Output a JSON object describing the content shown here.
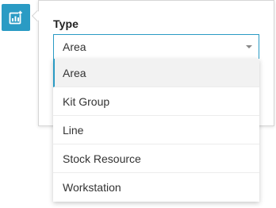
{
  "add_button": {
    "icon": "add-chart-icon",
    "color": "#2a9bc4"
  },
  "type_field": {
    "label": "Type",
    "selected": "Area",
    "options": [
      {
        "label": "Area",
        "selected": true
      },
      {
        "label": "Kit Group",
        "selected": false
      },
      {
        "label": "Line",
        "selected": false
      },
      {
        "label": "Stock Resource",
        "selected": false
      },
      {
        "label": "Workstation",
        "selected": false
      }
    ]
  },
  "colors": {
    "accent": "#2a9bc4",
    "text": "#333333",
    "label": "#222222",
    "selected_bg": "#f2f2f2"
  }
}
